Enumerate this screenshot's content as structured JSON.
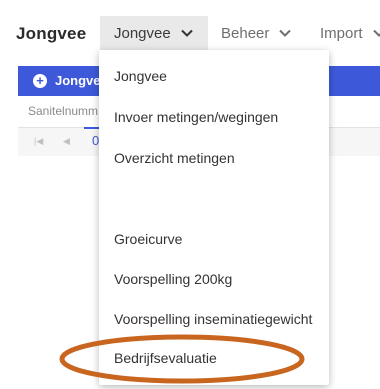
{
  "app": {
    "title": "Jongvee"
  },
  "nav": [
    {
      "label": "Jongvee",
      "icon": "chevron-down-icon"
    },
    {
      "label": "Beheer",
      "icon": "chevron-down-icon"
    },
    {
      "label": "Import",
      "icon": "chevron-down-icon"
    }
  ],
  "background": {
    "blue_bar_label": "Jongvee",
    "column_label": "Sanitelnumm",
    "pager_first": "|◀",
    "pager_prev": "◀",
    "pager_page": "0"
  },
  "dropdown": {
    "items": [
      "Jongvee",
      "Invoer metingen/wegingen",
      "Overzicht metingen",
      "Groeicurve",
      "Voorspelling 200kg",
      "Voorspelling inseminatiegewicht",
      "Bedrijfsevaluatie"
    ]
  },
  "colors": {
    "accent_blue": "#3d59d9",
    "highlight_orange": "#c8661f",
    "nav_active_bg": "#e9e9e9"
  }
}
